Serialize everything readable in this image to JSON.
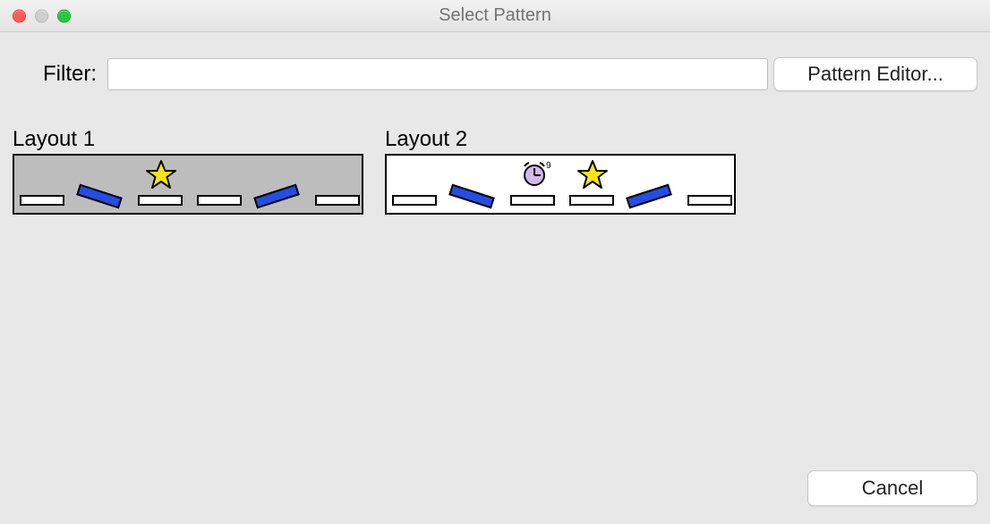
{
  "window": {
    "title": "Select Pattern"
  },
  "filter": {
    "label": "Filter:",
    "value": "",
    "placeholder": ""
  },
  "buttons": {
    "pattern_editor": "Pattern Editor...",
    "cancel": "Cancel"
  },
  "layouts": {
    "items": [
      {
        "label": "Layout 1",
        "selected": true
      },
      {
        "label": "Layout 2",
        "selected": false
      }
    ]
  }
}
